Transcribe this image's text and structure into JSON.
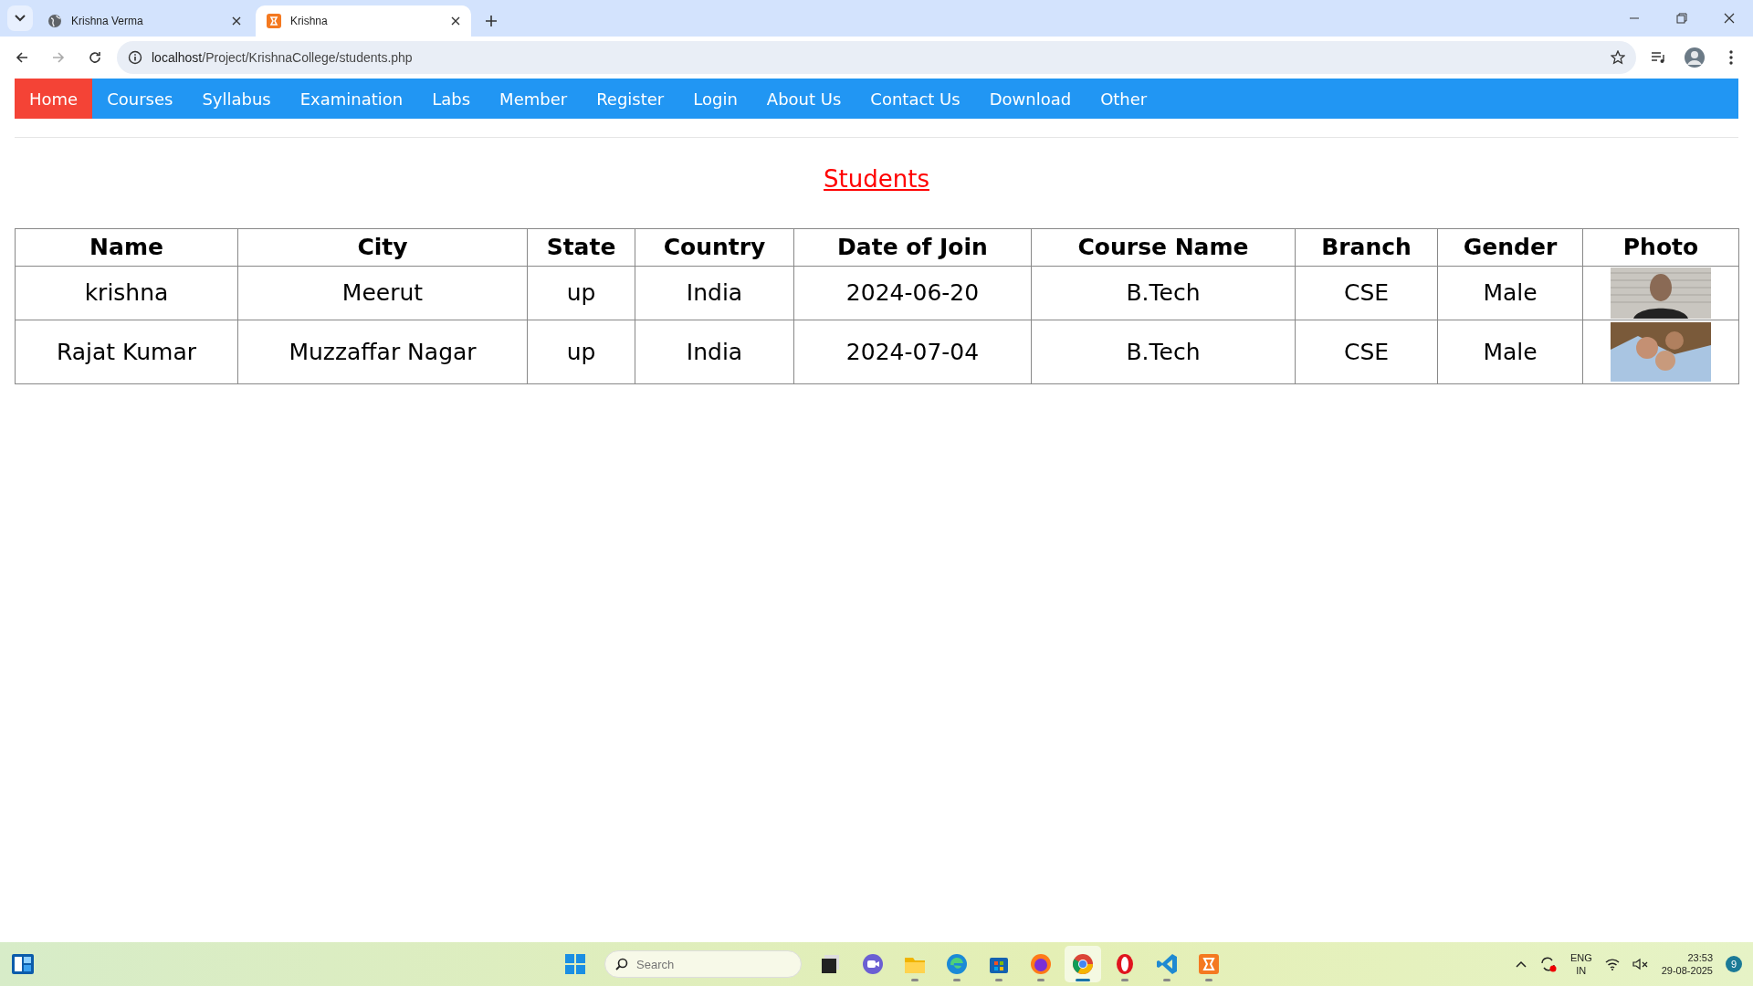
{
  "browser": {
    "tabs": [
      {
        "title": "Krishna Verma",
        "selected": false
      },
      {
        "title": "Krishna",
        "selected": true
      }
    ],
    "address": {
      "host": "localhost",
      "path": "/Project/KrishnaCollege/students.php"
    }
  },
  "nav": [
    {
      "label": "Home",
      "selected": true
    },
    {
      "label": "Courses",
      "selected": false
    },
    {
      "label": "Syllabus",
      "selected": false
    },
    {
      "label": "Examination",
      "selected": false
    },
    {
      "label": "Labs",
      "selected": false
    },
    {
      "label": "Member",
      "selected": false
    },
    {
      "label": "Register",
      "selected": false
    },
    {
      "label": "Login",
      "selected": false
    },
    {
      "label": "About Us",
      "selected": false
    },
    {
      "label": "Contact Us",
      "selected": false
    },
    {
      "label": "Download",
      "selected": false
    },
    {
      "label": "Other",
      "selected": false
    }
  ],
  "heading": "Students",
  "table": {
    "columns": [
      "Name",
      "City",
      "State",
      "Country",
      "Date of Join",
      "Course Name",
      "Branch",
      "Gender",
      "Photo"
    ],
    "rows": [
      {
        "cells": [
          "krishna",
          "Meerut",
          "up",
          "India",
          "2024-06-20",
          "B.Tech",
          "CSE",
          "Male"
        ]
      },
      {
        "cells": [
          "Rajat Kumar",
          "Muzzaffar Nagar",
          "up",
          "India",
          "2024-07-04",
          "B.Tech",
          "CSE",
          "Male"
        ]
      }
    ]
  },
  "taskbar": {
    "search": {
      "placeholder": "Search"
    },
    "apps": [
      {
        "selected": false
      },
      {
        "selected": false
      },
      {
        "selected": false
      },
      {
        "selected": false
      },
      {
        "selected": false
      },
      {
        "selected": false
      },
      {
        "selected": true
      },
      {
        "selected": false
      },
      {
        "selected": false
      },
      {
        "selected": false
      }
    ],
    "language": "ENG",
    "region": "IN",
    "time": "23:53",
    "date": "29-08-2025",
    "notifications": "9"
  }
}
